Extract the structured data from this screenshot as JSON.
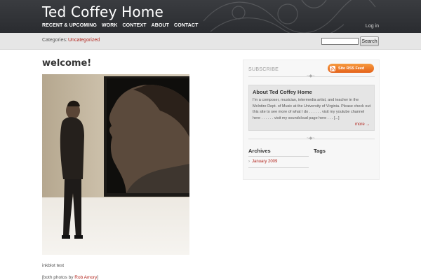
{
  "header": {
    "site_title": "Ted Coffey Home",
    "nav": [
      "RECENT & UPCOMING",
      "WORK",
      "CONTEXT",
      "ABOUT",
      "CONTACT"
    ],
    "login": "Log in"
  },
  "catbar": {
    "label": "Categories:",
    "category": "Uncategorized",
    "search_button": "Search",
    "search_value": ""
  },
  "post": {
    "title": "welcome!",
    "caption": "inkblot test",
    "credit_prefix": "[both photos by ",
    "credit_name": "Rob Amory",
    "credit_suffix": "]"
  },
  "sidebar": {
    "subscribe_label": "SUBSCRIBE",
    "rss_label": "Site RSS Feed",
    "about_title": "About Ted Coffey Home",
    "about_text": "I'm a composer, musician, intermedia artist, and teacher in the McIntire Dept. of Music at the University of Virginia. Please check out this site to see more of what I do . . . . . . visit my youtube channel here . . . . . . visit my soundcloud page here . . . [...]",
    "more_link": "more →",
    "archives_title": "Archives",
    "tags_title": "Tags",
    "archives": [
      "January 2009"
    ]
  },
  "colors": {
    "header_bg": "#2f3135",
    "accent_red": "#b3261e",
    "rss_orange": "#f0782a"
  }
}
